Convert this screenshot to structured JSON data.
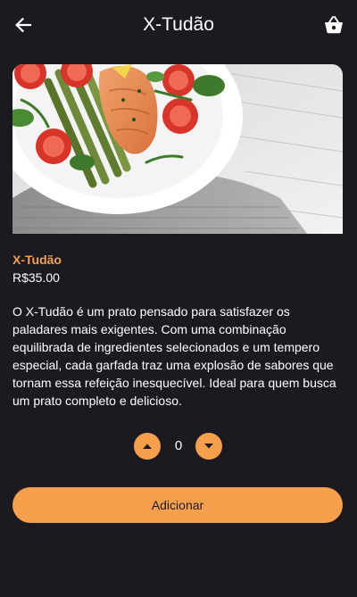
{
  "appbar": {
    "title": "X-Tudão",
    "back_icon": "arrow-left-icon",
    "cart_icon": "shopping-basket-icon"
  },
  "product": {
    "image": "salmon-asparagus-plate",
    "name": "X-Tudão",
    "price": "R$35.00",
    "description": "O X-Tudão é um prato pensado para satisfazer os paladares mais exigentes. Com uma combinação equilibrada de ingredientes selecionados e um tempero especial, cada garfada traz uma explosão de sabores que tornam essa refeição inesquecível. Ideal para quem busca um prato completo e delicioso."
  },
  "quantity": {
    "value": "0",
    "increase_icon": "caret-up-icon",
    "decrease_icon": "caret-down-icon"
  },
  "add_button": {
    "label": "Adicionar"
  },
  "colors": {
    "background": "#1c1a21",
    "accent": "#f6a04d",
    "text": "#ffffff"
  }
}
